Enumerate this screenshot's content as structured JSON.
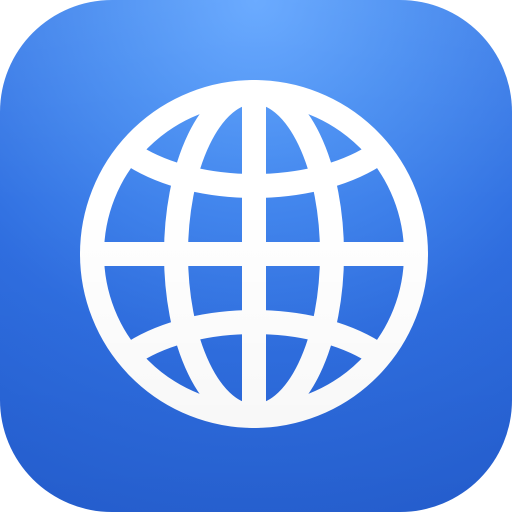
{
  "app_icon": {
    "icon": "globe-icon",
    "background_colors": [
      "#62a6ff",
      "#4a8ff2",
      "#2f6ee0",
      "#245fd3"
    ],
    "glyph_color": "#ffffff"
  }
}
